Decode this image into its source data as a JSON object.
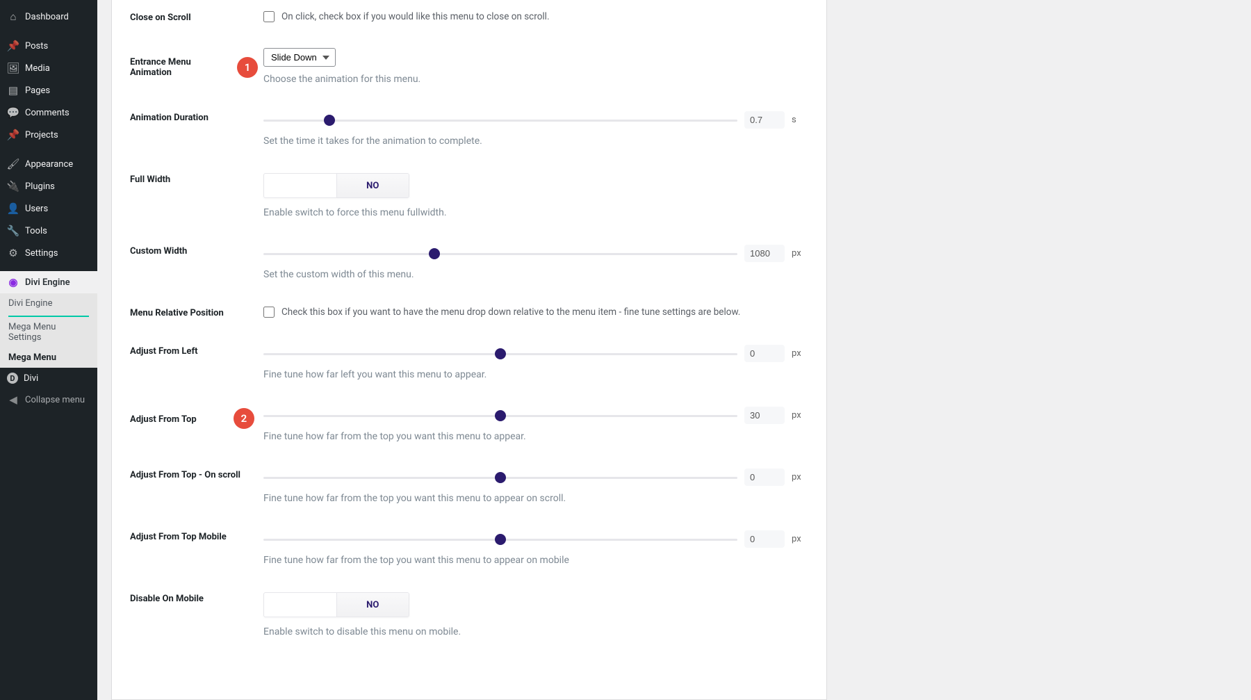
{
  "sidebar": {
    "items": [
      {
        "id": "dashboard",
        "label": "Dashboard",
        "icon": "⌂"
      },
      {
        "id": "posts",
        "label": "Posts",
        "icon": "📌"
      },
      {
        "id": "media",
        "label": "Media",
        "icon": "🖼"
      },
      {
        "id": "pages",
        "label": "Pages",
        "icon": "▤"
      },
      {
        "id": "comments",
        "label": "Comments",
        "icon": "💬"
      },
      {
        "id": "projects",
        "label": "Projects",
        "icon": "📌"
      },
      {
        "id": "appearance",
        "label": "Appearance",
        "icon": "🖌"
      },
      {
        "id": "plugins",
        "label": "Plugins",
        "icon": "🔌"
      },
      {
        "id": "users",
        "label": "Users",
        "icon": "👤"
      },
      {
        "id": "tools",
        "label": "Tools",
        "icon": "🔧"
      },
      {
        "id": "settings",
        "label": "Settings",
        "icon": "⚙"
      }
    ],
    "plugin": {
      "label": "Divi Engine",
      "icon": "◉",
      "sub": [
        {
          "id": "divi-engine",
          "label": "Divi Engine"
        },
        {
          "id": "mega-menu-settings",
          "label": "Mega Menu Settings"
        },
        {
          "id": "mega-menu",
          "label": "Mega Menu",
          "current": true
        }
      ]
    },
    "after": [
      {
        "id": "divi",
        "label": "Divi",
        "icon": "D"
      },
      {
        "id": "collapse",
        "label": "Collapse menu",
        "icon": "◀"
      }
    ]
  },
  "annotations": {
    "badge1": "1",
    "badge2": "2"
  },
  "fields": {
    "close_on_scroll": {
      "label": "Close on Scroll",
      "cb_text": "On click, check box if you would like this menu to close on scroll."
    },
    "entrance_anim": {
      "label": "Entrance Menu Animation",
      "value": "Slide Down",
      "desc": "Choose the animation for this menu."
    },
    "anim_duration": {
      "label": "Animation Duration",
      "value": "0.7",
      "unit": "s",
      "pct": 14,
      "desc": "Set the time it takes for the animation to complete."
    },
    "full_width": {
      "label": "Full Width",
      "value_no": "NO",
      "desc": "Enable switch to force this menu fullwidth."
    },
    "custom_width": {
      "label": "Custom Width",
      "value": "1080",
      "unit": "px",
      "pct": 36,
      "desc": "Set the custom width of this menu."
    },
    "menu_relative": {
      "label": "Menu Relative Position",
      "cb_text": "Check this box if you want to have the menu drop down relative to the menu item - fine tune settings are below."
    },
    "adjust_left": {
      "label": "Adjust From Left",
      "value": "0",
      "unit": "px",
      "pct": 50,
      "desc": "Fine tune how far left you want this menu to appear."
    },
    "adjust_top": {
      "label": "Adjust From Top",
      "value": "30",
      "unit": "px",
      "pct": 50,
      "desc": "Fine tune how far from the top you want this menu to appear."
    },
    "adjust_top_scroll": {
      "label": "Adjust From Top - On scroll",
      "value": "0",
      "unit": "px",
      "pct": 50,
      "desc": "Fine tune how far from the top you want this menu to appear on scroll."
    },
    "adjust_top_mobile": {
      "label": "Adjust From Top Mobile",
      "value": "0",
      "unit": "px",
      "pct": 50,
      "desc": "Fine tune how far from the top you want this menu to appear on mobile"
    },
    "disable_mobile": {
      "label": "Disable On Mobile",
      "value_no": "NO",
      "desc": "Enable switch to disable this menu on mobile."
    }
  }
}
